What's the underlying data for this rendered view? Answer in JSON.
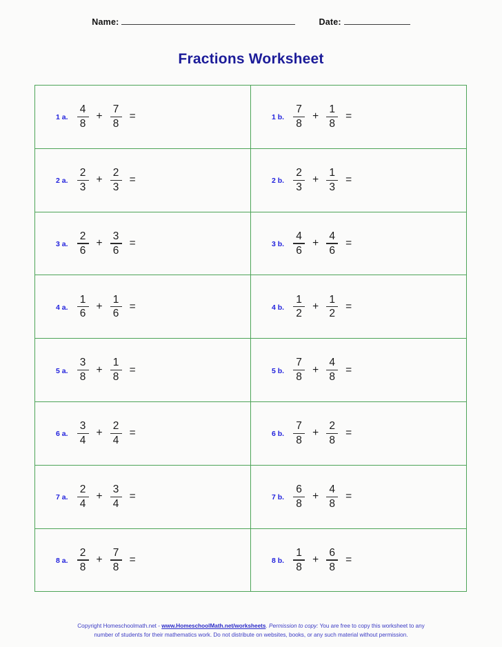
{
  "header": {
    "name_label": "Name:",
    "date_label": "Date:"
  },
  "title": "Fractions Worksheet",
  "colors": {
    "title": "#1c1c99",
    "label": "#2222dd",
    "table_border": "#4ba356",
    "footer": "#3a3ac4",
    "page_background": "#fbfbfa"
  },
  "problems": [
    {
      "left": {
        "label": "1 a.",
        "n1": "4",
        "d1": "8",
        "op": "+",
        "n2": "7",
        "d2": "8",
        "eq": "="
      },
      "right": {
        "label": "1 b.",
        "n1": "7",
        "d1": "8",
        "op": "+",
        "n2": "1",
        "d2": "8",
        "eq": "="
      }
    },
    {
      "left": {
        "label": "2 a.",
        "n1": "2",
        "d1": "3",
        "op": "+",
        "n2": "2",
        "d2": "3",
        "eq": "="
      },
      "right": {
        "label": "2 b.",
        "n1": "2",
        "d1": "3",
        "op": "+",
        "n2": "1",
        "d2": "3",
        "eq": "="
      }
    },
    {
      "left": {
        "label": "3 a.",
        "n1": "2",
        "d1": "6",
        "op": "+",
        "n2": "3",
        "d2": "6",
        "eq": "="
      },
      "right": {
        "label": "3 b.",
        "n1": "4",
        "d1": "6",
        "op": "+",
        "n2": "4",
        "d2": "6",
        "eq": "="
      }
    },
    {
      "left": {
        "label": "4 a.",
        "n1": "1",
        "d1": "6",
        "op": "+",
        "n2": "1",
        "d2": "6",
        "eq": "="
      },
      "right": {
        "label": "4 b.",
        "n1": "1",
        "d1": "2",
        "op": "+",
        "n2": "1",
        "d2": "2",
        "eq": "="
      }
    },
    {
      "left": {
        "label": "5 a.",
        "n1": "3",
        "d1": "8",
        "op": "+",
        "n2": "1",
        "d2": "8",
        "eq": "="
      },
      "right": {
        "label": "5 b.",
        "n1": "7",
        "d1": "8",
        "op": "+",
        "n2": "4",
        "d2": "8",
        "eq": "="
      }
    },
    {
      "left": {
        "label": "6 a.",
        "n1": "3",
        "d1": "4",
        "op": "+",
        "n2": "2",
        "d2": "4",
        "eq": "="
      },
      "right": {
        "label": "6 b.",
        "n1": "7",
        "d1": "8",
        "op": "+",
        "n2": "2",
        "d2": "8",
        "eq": "="
      }
    },
    {
      "left": {
        "label": "7 a.",
        "n1": "2",
        "d1": "4",
        "op": "+",
        "n2": "3",
        "d2": "4",
        "eq": "="
      },
      "right": {
        "label": "7 b.",
        "n1": "6",
        "d1": "8",
        "op": "+",
        "n2": "4",
        "d2": "8",
        "eq": "="
      }
    },
    {
      "left": {
        "label": "8 a.",
        "n1": "2",
        "d1": "8",
        "op": "+",
        "n2": "7",
        "d2": "8",
        "eq": "="
      },
      "right": {
        "label": "8 b.",
        "n1": "1",
        "d1": "8",
        "op": "+",
        "n2": "6",
        "d2": "8",
        "eq": "="
      }
    }
  ],
  "footer": {
    "copyright_prefix": "Copyright Homeschoolmath.net - ",
    "link_text": "www.HomeschoolMath.net/worksheets",
    "permission_label": ". Permission to copy:",
    "permission_rest": " You are free to copy this worksheet to any",
    "line2": "number of students for their mathematics work. Do not distribute on websites, books, or any such material without permission."
  }
}
